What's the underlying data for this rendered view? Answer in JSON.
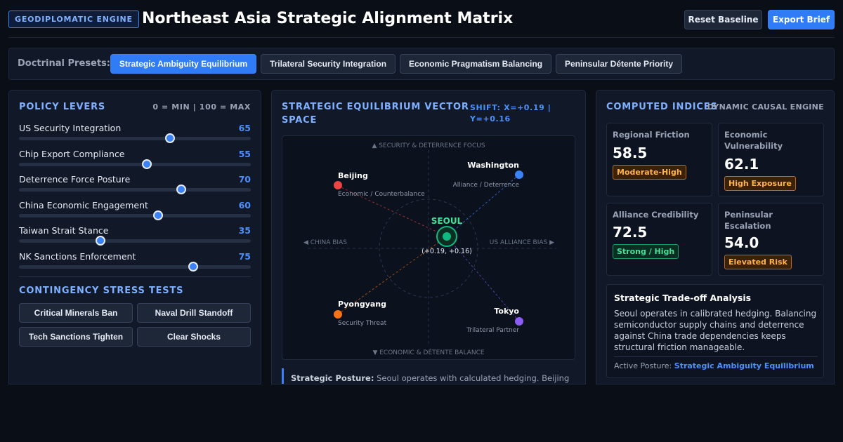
{
  "header": {
    "badge": "GEODIPLOMATIC ENGINE",
    "title": "Northeast Asia Strategic Alignment Matrix",
    "reset_label": "Reset Baseline",
    "export_label": "Export Brief"
  },
  "presets": {
    "label": "Doctrinal Presets:",
    "items": [
      {
        "label": "Strategic Ambiguity Equilibrium",
        "active": true
      },
      {
        "label": "Trilateral Security Integration",
        "active": false
      },
      {
        "label": "Economic Pragmatism Balancing",
        "active": false
      },
      {
        "label": "Peninsular Détente Priority",
        "active": false
      }
    ]
  },
  "levers": {
    "title": "POLICY LEVERS",
    "note": "0 = MIN | 100 = MAX",
    "items": [
      {
        "label": "US Security Integration",
        "value": 65
      },
      {
        "label": "Chip Export Compliance",
        "value": 55
      },
      {
        "label": "Deterrence Force Posture",
        "value": 70
      },
      {
        "label": "China Economic Engagement",
        "value": 60
      },
      {
        "label": "Taiwan Strait Stance",
        "value": 35
      },
      {
        "label": "NK Sanctions Enforcement",
        "value": 75
      }
    ]
  },
  "stress": {
    "title": "CONTINGENCY STRESS TESTS",
    "items": [
      "Critical Minerals Ban",
      "Naval Drill Standoff",
      "Tech Sanctions Tighten",
      "Clear Shocks"
    ]
  },
  "vector": {
    "title": "STRATEGIC EQUILIBRIUM VECTOR SPACE",
    "shift_line1": "SHIFT: X=+0.19 |",
    "shift_line2": "Y=+0.16",
    "axis_top": "▲ SECURITY & DETERRENCE FOCUS",
    "axis_bottom": "▼ ECONOMIC & DÉTENTE BALANCE",
    "axis_left": "◀ CHINA BIAS",
    "axis_right": "US ALLIANCE BIAS ▶",
    "center_label": "SEOUL",
    "center_coord": "(+0.19, +0.16)",
    "nodes": [
      {
        "name": "Beijing",
        "role": "Economic / Counterbalance",
        "color": "#ef4444"
      },
      {
        "name": "Washington",
        "role": "Alliance / Deterrence",
        "color": "#3b82f6"
      },
      {
        "name": "Pyongyang",
        "role": "Security Threat",
        "color": "#f97316"
      },
      {
        "name": "Tokyo",
        "role": "Trilateral Partner",
        "color": "#8b5cf6"
      }
    ],
    "posture_label": "Strategic Posture:",
    "posture_text": "Seoul operates with calculated hedging. Beijing"
  },
  "indices": {
    "title": "COMPUTED INDICES",
    "note": "DYNAMIC CAUSAL ENGINE",
    "items": [
      {
        "label": "Regional Friction",
        "value": "58.5",
        "badge": "Moderate-High",
        "tone": "orange"
      },
      {
        "label": "Economic Vulnerability",
        "value": "62.1",
        "badge": "High Exposure",
        "tone": "orange"
      },
      {
        "label": "Alliance Credibility",
        "value": "72.5",
        "badge": "Strong / High",
        "tone": "green"
      },
      {
        "label": "Peninsular Escalation",
        "value": "54.0",
        "badge": "Elevated Risk",
        "tone": "orange"
      }
    ]
  },
  "tradeoff": {
    "title": "Strategic Trade-off Analysis",
    "text": "Seoul operates in calibrated hedging. Balancing semiconductor supply chains and deterrence against China trade dependencies keeps structural friction manageable.",
    "active_label": "Active Posture:",
    "active_value": "Strategic Ambiguity Equilibrium"
  },
  "colors": {
    "accent": "#3b82f6",
    "seoul": "#10b981",
    "warning": "#f59e0b"
  }
}
